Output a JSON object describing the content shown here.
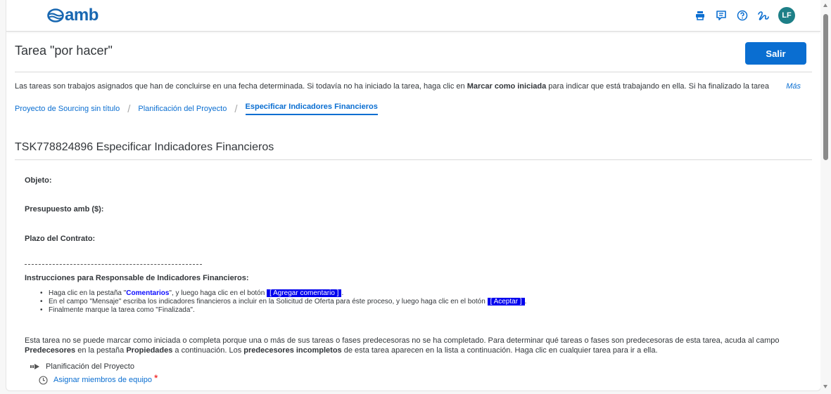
{
  "header": {
    "logo_text": "amb",
    "icons": [
      "printer-icon",
      "feedback-icon",
      "help-icon",
      "signature-icon"
    ],
    "avatar_initials": "LF"
  },
  "page": {
    "title": "Tarea \"por hacer\"",
    "exit_label": "Salir",
    "description_1": "Las tareas son trabajos asignados que han de concluirse en una fecha determinada. Si todavía no ha iniciado la tarea, haga clic en ",
    "description_bold_1": "Marcar como iniciada",
    "description_2": " para indicar que está trabajando en ella. Si ha finalizado la tarea",
    "more_label": "Más"
  },
  "breadcrumb": {
    "items": [
      "Proyecto de Sourcing sin título",
      "Planificación del Proyecto"
    ],
    "current": "Especificar Indicadores Financieros"
  },
  "task": {
    "title": "TSK778824896 Especificar Indicadores Financieros",
    "field_objeto": "Objeto:",
    "field_presupuesto": "Presupuesto amb ($):",
    "field_plazo": "Plazo del Contrato:",
    "instructions_heading": "Instrucciones para Responsable de Indicadores Financieros:",
    "bullet1_a": "Haga clic en la pestaña \"",
    "bullet1_link": "Comentarios",
    "bullet1_b": "\", y luego haga clic en el botón ",
    "bullet1_button": "[ Agregar comentario ]",
    "bullet1_c": ".",
    "bullet2_a": "En el campo \"Mensaje\" escriba los indicadores financieros a incluir en la Solicitud de Oferta para éste proceso, y luego haga clic en el botón ",
    "bullet2_button": "[ Aceptar ]",
    "bullet2_c": ".",
    "bullet3": "Finalmente marque la tarea como \"Finalizada\".",
    "para_1": "Esta tarea no se puede marcar como iniciada o completa porque una o más de sus tareas o fases predecesoras no se ha completado. Para determinar qué tareas o fases son predecesoras de esta tarea, acuda al campo ",
    "para_bold_1": "Predecesores",
    "para_2": " en la pestaña ",
    "para_bold_2": "Propiedades",
    "para_3": " a continuación. Los ",
    "para_bold_3": "predecesores incompletos",
    "para_4": " de esta tarea aparecen en la lista a continuación. Haga clic en cualquier tarea para ir a ella.",
    "predecessor_phase": "Planificación del Proyecto",
    "predecessor_task": "Asignar miembros de equipo",
    "required_mark": "*"
  },
  "colors": {
    "accent": "#0a6ed1",
    "avatar": "#1d7f87",
    "instruction_button_bg": "#0000ee",
    "required": "#e00000"
  }
}
